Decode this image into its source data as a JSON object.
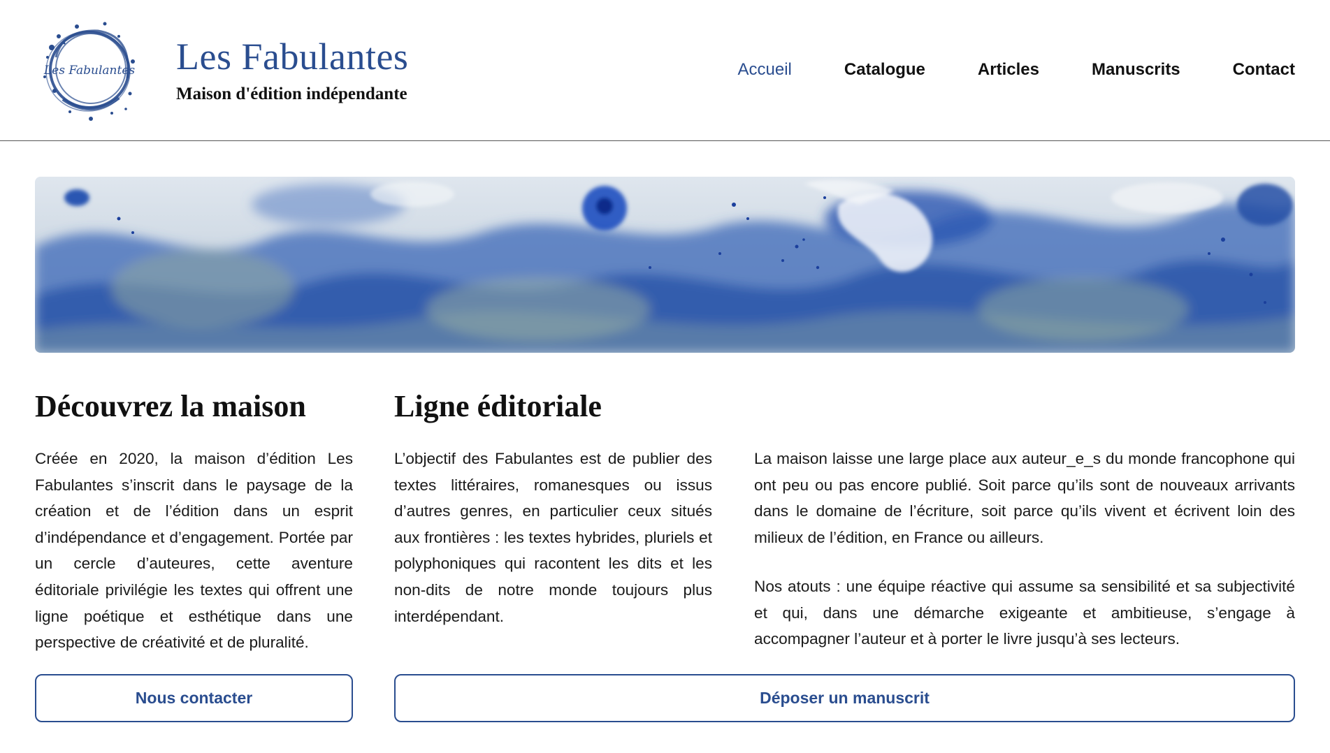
{
  "brand": {
    "logo_text": "Les Fabulantes",
    "title": "Les Fabulantes",
    "subtitle": "Maison d'édition indépendante"
  },
  "nav": {
    "items": [
      {
        "label": "Accueil",
        "active": true
      },
      {
        "label": "Catalogue",
        "active": false
      },
      {
        "label": "Articles",
        "active": false
      },
      {
        "label": "Manuscrits",
        "active": false
      },
      {
        "label": "Contact",
        "active": false
      }
    ]
  },
  "colors": {
    "brand_blue": "#2a4d8f",
    "text": "#1a1a1a"
  },
  "banner": {
    "icon": "watercolor-banner-image"
  },
  "maison": {
    "heading": "Découvrez la maison",
    "text": "Créée en 2020, la maison d’édition Les Fabulantes s’inscrit dans le paysage de la création et de l’édition dans un esprit d’indépendance et d’engagement. Portée par un cercle d’auteures, cette aventure éditoriale privilégie les textes qui offrent une ligne poétique et esthétique dans une perspective de créativité et de pluralité.",
    "button_label": "Nous contacter"
  },
  "ligne": {
    "heading": "Ligne éditoriale",
    "text_1": "L’objectif des Fabulantes est de publier des textes littéraires, romanesques ou issus d’autres genres, en particulier ceux situés aux frontières : les textes hybrides, pluriels et polyphoniques qui racontent les dits et les non-dits de notre monde toujours plus interdépendant.",
    "text_2": "La maison laisse une large place aux auteur_e_s du monde francophone qui ont peu ou pas encore publié. Soit parce qu’ils sont de nouveaux arrivants dans le domaine de l’écriture, soit parce qu’ils vivent et écrivent loin des milieux de l’édition, en France ou ailleurs.",
    "text_3": "Nos atouts : une équipe réactive qui assume sa sensibilité et sa subjectivité et qui, dans une démarche exigeante et ambitieuse, s’engage à accompagner l’auteur et à porter le livre jusqu’à ses lecteurs.",
    "button_label": "Déposer un manuscrit"
  }
}
